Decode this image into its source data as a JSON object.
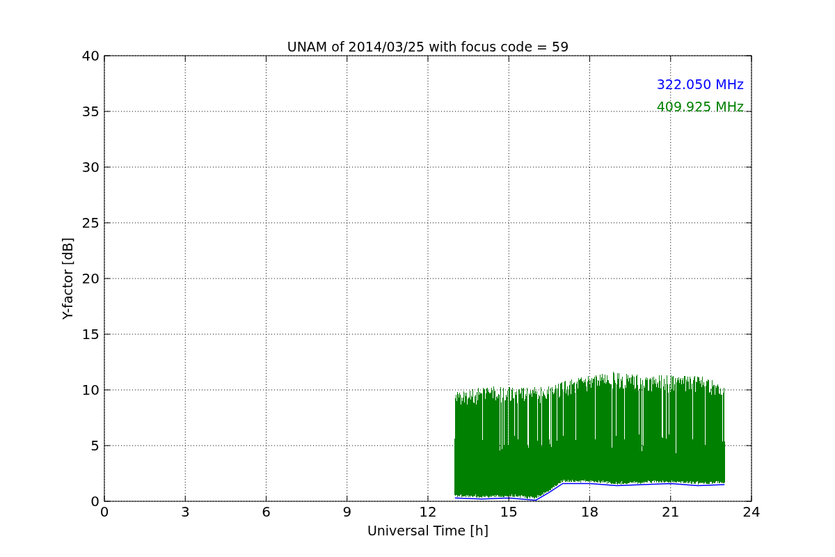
{
  "chart_data": {
    "type": "line",
    "title": "UNAM of 2014/03/25 with focus code = 59",
    "xlabel": "Universal Time [h]",
    "ylabel": "Y-factor [dB]",
    "xlim": [
      0,
      24
    ],
    "ylim": [
      0,
      40
    ],
    "grid": true,
    "xticks": [
      0,
      3,
      6,
      9,
      12,
      15,
      18,
      21,
      24
    ],
    "yticks": [
      0,
      5,
      10,
      15,
      20,
      25,
      30,
      35,
      40
    ],
    "x": [
      13,
      14,
      15,
      16,
      16.5,
      17,
      18,
      19,
      20,
      21,
      22,
      23
    ],
    "series": [
      {
        "name": "322.050 MHz",
        "color": "#0000ff",
        "values": [
          0.3,
          0.2,
          0.3,
          0.1,
          0.8,
          1.6,
          1.6,
          1.4,
          1.5,
          1.6,
          1.4,
          1.5
        ]
      }
    ]
  },
  "legend": [
    {
      "label": "409.925 MHz",
      "color": "#008000"
    }
  ]
}
